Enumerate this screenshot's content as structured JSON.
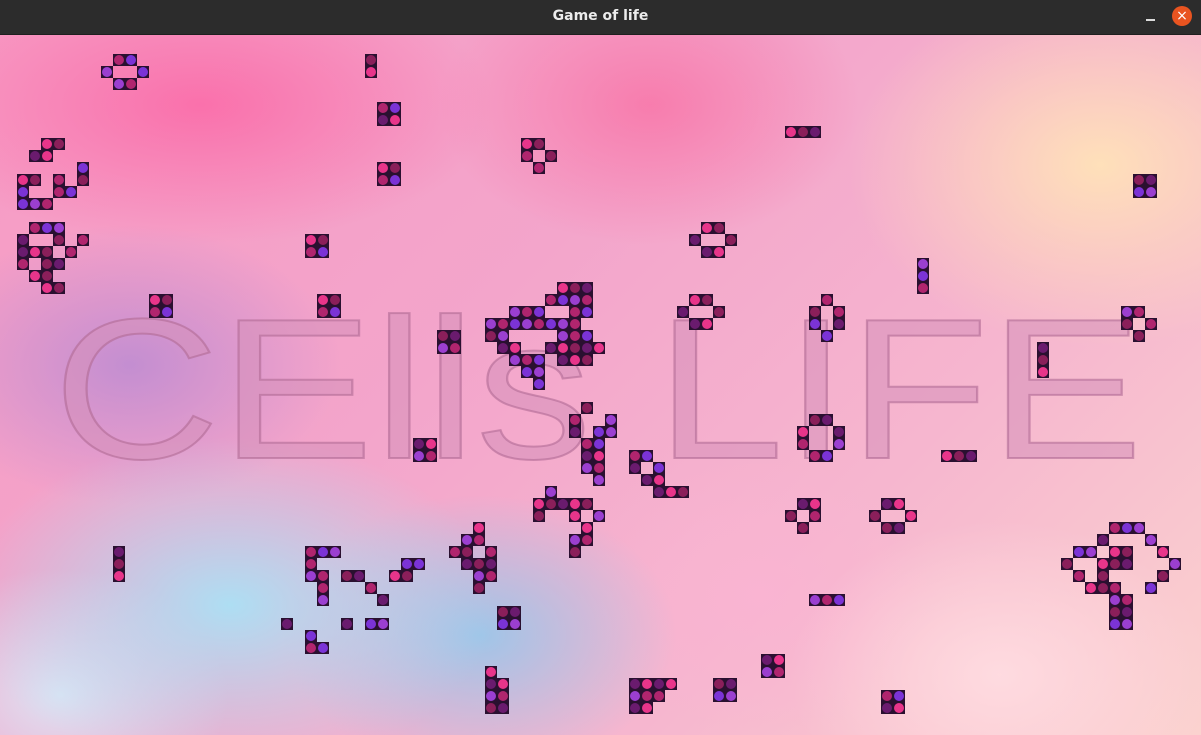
{
  "window": {
    "title": "Game of life",
    "close_symbol": "×"
  },
  "banner": {
    "text": "CElls LIFE",
    "color": "#d68fb9"
  },
  "colors": {
    "titlebar": "#2c2c2c",
    "close_button": "#e95420",
    "cell_palette": [
      "#b0256e",
      "#e8358a",
      "#7b33d6",
      "#8a1f5a",
      "#9b3fd0",
      "#6a1b6e"
    ]
  }
}
